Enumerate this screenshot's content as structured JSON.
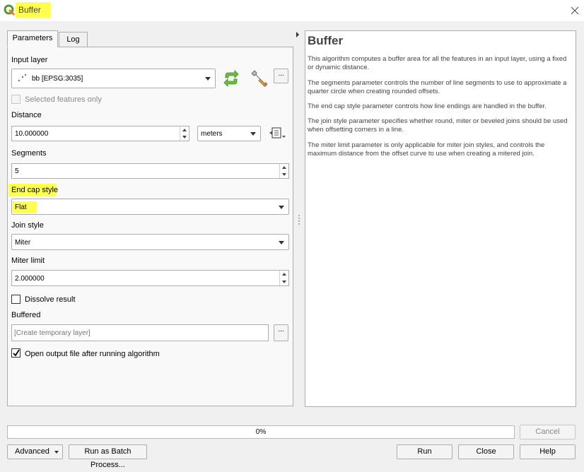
{
  "window": {
    "title": "Buffer",
    "close_icon": "close-icon"
  },
  "tabs": [
    {
      "label": "Parameters",
      "active": true
    },
    {
      "label": "Log",
      "active": false
    }
  ],
  "params": {
    "input_layer": {
      "label": "Input layer",
      "value": "bb [EPSG:3035]",
      "icon": "point-layer-icon"
    },
    "selected_only": {
      "label": "Selected features only",
      "checked": false,
      "enabled": false
    },
    "distance": {
      "label": "Distance",
      "value": "10.000000",
      "unit": "meters"
    },
    "segments": {
      "label": "Segments",
      "value": "5"
    },
    "end_cap": {
      "label": "End cap style",
      "value": "Flat"
    },
    "join_style": {
      "label": "Join style",
      "value": "Miter"
    },
    "miter_limit": {
      "label": "Miter limit",
      "value": "2.000000"
    },
    "dissolve": {
      "label": "Dissolve result",
      "checked": false
    },
    "buffered": {
      "label": "Buffered",
      "placeholder": "[Create temporary layer]"
    },
    "open_output": {
      "label": "Open output file after running algorithm",
      "checked": true
    },
    "ellipsis": "..."
  },
  "help": {
    "title": "Buffer",
    "paragraphs": [
      "This algorithm computes a buffer area for all the features in an input layer, using a fixed or dynamic distance.",
      "The segments parameter controls the number of line segments to use to approximate a quarter circle when creating rounded offsets.",
      "The end cap style parameter controls how line endings are handled in the buffer.",
      "The join style parameter specifies whether round, miter or beveled joins should be used when offsetting corners in a line.",
      "The miter limit parameter is only applicable for miter join styles, and controls the maximum distance from the offset curve to use when creating a mitered join."
    ]
  },
  "progress": {
    "text": "0%",
    "value": 0
  },
  "buttons": {
    "cancel": "Cancel",
    "advanced": "Advanced",
    "batch": "Run as Batch Process...",
    "run": "Run",
    "close": "Close",
    "help": "Help"
  },
  "colors": {
    "highlight": "#ffff4d",
    "qgis_green": "#589632"
  }
}
